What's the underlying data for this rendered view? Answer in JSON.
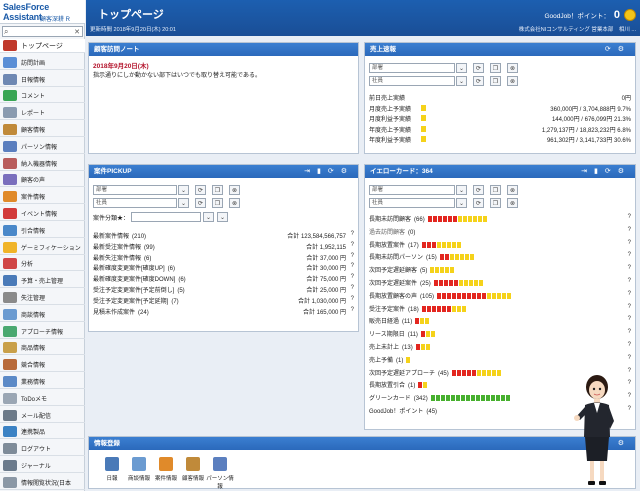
{
  "brand": {
    "line1": "SalesForce Assistant",
    "line2": "顧客深耕 R"
  },
  "sidebar": {
    "items": [
      {
        "label": "トップページ",
        "color": "#c0392b"
      },
      {
        "label": "訪問計画",
        "color": "#5b8fd6"
      },
      {
        "label": "日報情報",
        "color": "#6e88b3"
      },
      {
        "label": "コメント",
        "color": "#3aa655"
      },
      {
        "label": "レポート",
        "color": "#8a9bb0"
      },
      {
        "label": "顧客情報",
        "color": "#c08a3a"
      },
      {
        "label": "パーソン情報",
        "color": "#5b7fbf"
      },
      {
        "label": "納入機器情報",
        "color": "#b85c5c"
      },
      {
        "label": "顧客の声",
        "color": "#7a6fbd"
      },
      {
        "label": "案件情報",
        "color": "#e08a2a"
      },
      {
        "label": "イベント情報",
        "color": "#d23a3a"
      },
      {
        "label": "引合情報",
        "color": "#4a88c9"
      },
      {
        "label": "ゲーミフィケーション",
        "color": "#f0b429"
      },
      {
        "label": "分析",
        "color": "#d04646"
      },
      {
        "label": "予算・売上管理",
        "color": "#4a7ab8"
      },
      {
        "label": "失注管理",
        "color": "#8a8a8a"
      },
      {
        "label": "商談情報",
        "color": "#6b9bd1"
      },
      {
        "label": "アプローチ情報",
        "color": "#4aa870"
      },
      {
        "label": "商品情報",
        "color": "#c9a04a"
      },
      {
        "label": "競合情報",
        "color": "#b86a3a"
      },
      {
        "label": "業務情報",
        "color": "#5c8ac7"
      },
      {
        "label": "ToDoメモ",
        "color": "#9aa6b4"
      },
      {
        "label": "メール配信",
        "color": "#6c7a89"
      },
      {
        "label": "連携製品",
        "color": "#3b82c4"
      },
      {
        "label": "ログアウト",
        "color": "#7f8c99"
      },
      {
        "label": "ジャーナル",
        "color": "#6b7b8c"
      },
      {
        "label": "情報閲覧状況(日本",
        "color": "#8b98a6"
      }
    ]
  },
  "header": {
    "title": "トップページ",
    "updated": "更新時間 2018年9月20日(木) 20:01",
    "goodjob_label": "GoodJob！ポイント：",
    "goodjob_value": "0",
    "company": "株式会社NIコンサルティング 営業本部　相川 ..."
  },
  "note": {
    "title": "顧客訪問ノート",
    "date": "2018年9月20日(木)",
    "text": "指示通りにしか動かない部下はいつでも取り替え可能である。"
  },
  "sales": {
    "title": "売上速報",
    "dept_placeholder": "部署",
    "staff_placeholder": "社員",
    "rows": [
      {
        "label": "前日売上実績",
        "value": "0円",
        "flag": false
      },
      {
        "label": "月度売上予実績",
        "value": "360,000円 / 3,704,888円 9.7%",
        "flag": true
      },
      {
        "label": "月度利益予実績",
        "value": "144,000円 / 676,099円 21.3%",
        "flag": true
      },
      {
        "label": "年度売上予実績",
        "value": "1,279,137円 / 18,823,232円 6.8%",
        "flag": true
      },
      {
        "label": "年度利益予実績",
        "value": "961,302円 / 3,141,733円 30.6%",
        "flag": true
      }
    ]
  },
  "pickup": {
    "title": "案件PICKUP",
    "dept_placeholder": "部署",
    "staff_placeholder": "社員",
    "category_label": "案件分類★：",
    "rows": [
      {
        "label": "最新案件情報",
        "count": "(210)",
        "total": "合計 123,584,566,757"
      },
      {
        "label": "最新受注案件情報",
        "count": "(99)",
        "total": "合計 1,952,115"
      },
      {
        "label": "最新失注案件情報",
        "count": "(6)",
        "total": "合計 37,000 円"
      },
      {
        "label": "最新確度変更案件[確度UP]",
        "count": "(6)",
        "total": "合計 30,000 円"
      },
      {
        "label": "最新確度変更案件[確度DOWN]",
        "count": "(6)",
        "total": "合計 75,000 円"
      },
      {
        "label": "受注予定変更案件[予定前倒し]",
        "count": "(5)",
        "total": "合計 25,000 円"
      },
      {
        "label": "受注予定変更案件[予定延期]",
        "count": "(7)",
        "total": "合計 1,030,000 円"
      },
      {
        "label": "見積未作成案件",
        "count": "(24)",
        "total": "合計 165,000 円"
      }
    ]
  },
  "yellow": {
    "title": "イエローカード：364",
    "dept_placeholder": "部署",
    "staff_placeholder": "社員",
    "rows": [
      {
        "label": "長期未訪問顧客",
        "count": "(66)",
        "red": 6,
        "yellow": 6,
        "green": 0
      },
      {
        "label": "過去訪問顧客",
        "count": "(0)",
        "red": 0,
        "yellow": 0,
        "green": 0
      },
      {
        "label": "長期放置案件",
        "count": "(17)",
        "red": 3,
        "yellow": 5,
        "green": 0
      },
      {
        "label": "長期未訪問パーソン",
        "count": "(15)",
        "red": 2,
        "yellow": 5,
        "green": 0
      },
      {
        "label": "次回予定遅延顧客",
        "count": "(5)",
        "red": 0,
        "yellow": 5,
        "green": 0
      },
      {
        "label": "次回予定遅延案件",
        "count": "(25)",
        "red": 5,
        "yellow": 5,
        "green": 0
      },
      {
        "label": "長期放置顧客の声",
        "count": "(105)",
        "red": 10,
        "yellow": 5,
        "green": 0
      },
      {
        "label": "受注予定案件",
        "count": "(18)",
        "red": 6,
        "yellow": 3,
        "green": 0
      },
      {
        "label": "販売日経過",
        "count": "(11)",
        "red": 1,
        "yellow": 2,
        "green": 0
      },
      {
        "label": "リース期限日",
        "count": "(11)",
        "red": 1,
        "yellow": 2,
        "green": 0
      },
      {
        "label": "売上未計上",
        "count": "(13)",
        "red": 1,
        "yellow": 2,
        "green": 0
      },
      {
        "label": "売上予備",
        "count": "(1)",
        "red": 0,
        "yellow": 1,
        "green": 0
      },
      {
        "label": "次回予定遅延アプローチ",
        "count": "(45)",
        "red": 5,
        "yellow": 5,
        "green": 0
      },
      {
        "label": "長期放置引合",
        "count": "(1)",
        "red": 1,
        "yellow": 1,
        "green": 0
      },
      {
        "label": "グリーンカード",
        "count": "(342)",
        "red": 0,
        "yellow": 0,
        "green": 16
      },
      {
        "label": "GoodJob！ポイント",
        "count": "(45)",
        "red": 0,
        "yellow": 0,
        "green": 0
      }
    ]
  },
  "registration": {
    "title": "情報登録",
    "items": [
      {
        "label": "日報",
        "color": "#4a7ab8"
      },
      {
        "label": "商談情報",
        "color": "#6b9bd1"
      },
      {
        "label": "案件情報",
        "color": "#e08a2a"
      },
      {
        "label": "顧客情報",
        "color": "#c08a3a"
      },
      {
        "label": "パーソン情報",
        "color": "#5b7fbf"
      }
    ]
  }
}
